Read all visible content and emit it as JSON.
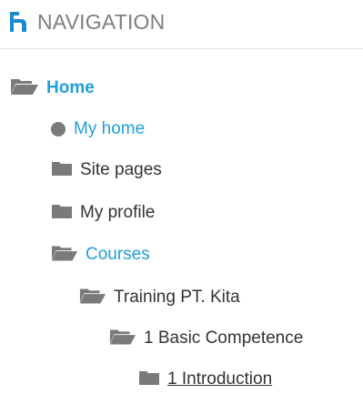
{
  "block": {
    "title": "NAVIGATION",
    "icon": "navigation-block-icon"
  },
  "tree": {
    "home": {
      "label": "Home",
      "icon": "folder-open-icon"
    },
    "my_home": {
      "label": "My home",
      "icon": "circle-bullet-icon"
    },
    "site_pages": {
      "label": "Site pages",
      "icon": "folder-icon"
    },
    "my_profile": {
      "label": "My profile",
      "icon": "folder-icon"
    },
    "courses": {
      "label": "Courses",
      "icon": "folder-open-icon"
    },
    "course": {
      "label": "Training PT. Kita",
      "icon": "folder-open-icon"
    },
    "section": {
      "label": "1 Basic Competence",
      "icon": "folder-open-icon"
    },
    "topic": {
      "label": "1 Introduction",
      "icon": "folder-icon"
    }
  },
  "colors": {
    "link": "#20a0d8",
    "text": "#333333",
    "icon": "#7a7a7a",
    "header": "#7c7f82"
  }
}
